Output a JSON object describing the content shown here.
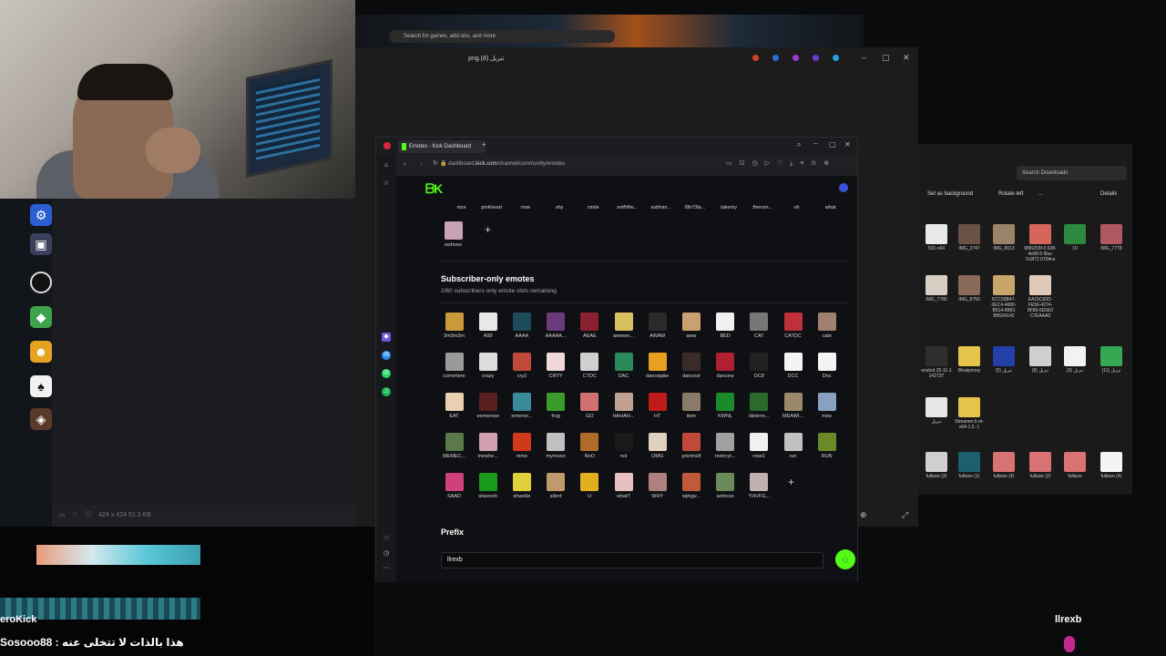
{
  "app": {
    "tab_title": "Emotes - Kick Dashboard",
    "url_prefix": "dashboard.",
    "url_domain": "kick.com",
    "url_path": "/channel/community/emotes",
    "logo_text": "ᗷK"
  },
  "background": {
    "game_search_placeholder": "Search for games, add-ons, and more",
    "viewer_title": "png.(8) تنزيل",
    "viewer_status": "424 x 424     51.3 KB",
    "explorer_search": "Search Downloads",
    "explorer_toolbar": [
      "Set as background",
      "Rotate left",
      "...",
      "Details"
    ]
  },
  "explorer_files": [
    {
      "label": "501-x64",
      "color": "#e8e8e8"
    },
    {
      "label": "IMG_2747",
      "color": "#6b5246"
    },
    {
      "label": "IMG_8013",
      "color": "#9a8366"
    },
    {
      "label": "6f0b203f-0 638-4e89-9 5ba-7e3f72 0704ce",
      "color": "#d6665a"
    },
    {
      "label": "10",
      "color": "#2b8a3e"
    },
    {
      "label": "IMG_7778",
      "color": "#b0585f"
    },
    {
      "label": "IMG_7780",
      "color": "#d9cfc4"
    },
    {
      "label": "IMG_8750",
      "color": "#8a6a58"
    },
    {
      "label": "6CC36B47- 0EC4-4680- B514-86B1 BB934142",
      "color": "#c8a56a"
    },
    {
      "label": "EA15C60D- FE56-4274- 8F80-5E5E0 C7EAAA0",
      "color": "#e0c9b6"
    },
    {
      "label": "enshot 25-11-1 142737",
      "color": "#2e2e2e"
    },
    {
      "label": "Bloatynosy",
      "color": "#e6c34a"
    },
    {
      "label": "تنزيل (5)",
      "color": "#2340a8"
    },
    {
      "label": "تنزيل (8)",
      "color": "#cfcfcf"
    },
    {
      "label": "تنزيل (3)",
      "color": "#f2f2f2"
    },
    {
      "label": "تنزيل (11)",
      "color": "#34a853"
    },
    {
      "label": "تنزيل",
      "color": "#e6e6e6"
    },
    {
      "label": "Streamer.b ot-x64-1.0. 1",
      "color": "#e6c34a"
    },
    {
      "label": "fullsize (3)",
      "color": "#cfcfcf"
    },
    {
      "label": "fullsize (1)",
      "color": "#1c6070"
    },
    {
      "label": "fullsize (4)",
      "color": "#d97272"
    },
    {
      "label": "fullsize (2)",
      "color": "#d97272"
    },
    {
      "label": "fullsize",
      "color": "#d97272"
    },
    {
      "label": "fullsize (4)",
      "color": "#f4f4f4"
    }
  ],
  "public_emotes_tail": [
    "nice",
    "pinkheart",
    "rose",
    "shy",
    "smile",
    "snifhflw...",
    "subhan...",
    "t9b73la...",
    "takemy",
    "therum...",
    "uh",
    "what"
  ],
  "public_last": {
    "label": "wshooo",
    "color": "#c7a2b3"
  },
  "subscriber": {
    "title": "Subscriber-only emotes",
    "desc": "2/60 subscribers only emote slots remaining",
    "emotes": [
      {
        "label": "3m3m3m",
        "color": "#c89a3a"
      },
      {
        "label": "A99",
        "color": "#e8e8e8"
      },
      {
        "label": "AAAA",
        "color": "#1d4b5c"
      },
      {
        "label": "AAAAA...",
        "color": "#6a3a7a"
      },
      {
        "label": "AEAE",
        "color": "#8a2030"
      },
      {
        "label": "aeeeee...",
        "color": "#d8c060"
      },
      {
        "label": "AWAW",
        "color": "#2a2a2a"
      },
      {
        "label": "aww",
        "color": "#c9a070"
      },
      {
        "label": "BED",
        "color": "#f0f0f0"
      },
      {
        "label": "CAT",
        "color": "#777777"
      },
      {
        "label": "CATDC",
        "color": "#c0303a"
      },
      {
        "label": "cate",
        "color": "#a08070"
      },
      {
        "label": "comehere",
        "color": "#9a9a9a"
      },
      {
        "label": "crazy",
        "color": "#dddddd"
      },
      {
        "label": "cry2",
        "color": "#c04a3a"
      },
      {
        "label": "CRYY",
        "color": "#f0d8d8"
      },
      {
        "label": "CTDC",
        "color": "#d0d0d0"
      },
      {
        "label": "DAC",
        "color": "#2a8a5a"
      },
      {
        "label": "dancejake",
        "color": "#e8a020"
      },
      {
        "label": "dancest",
        "color": "#3a2a2a"
      },
      {
        "label": "dancew",
        "color": "#b02030"
      },
      {
        "label": "DC8",
        "color": "#222222"
      },
      {
        "label": "DCC",
        "color": "#f4f4f4"
      },
      {
        "label": "Dnc",
        "color": "#f4f4f4"
      },
      {
        "label": "EAT",
        "color": "#e8d0b0"
      },
      {
        "label": "eememee",
        "color": "#5a2020"
      },
      {
        "label": "ememe...",
        "color": "#3a8a9a"
      },
      {
        "label": "frog",
        "color": "#3a9a2a"
      },
      {
        "label": "GO",
        "color": "#d07070"
      },
      {
        "label": "HAHAH...",
        "color": "#c0a090"
      },
      {
        "label": "HT",
        "color": "#c01a1a"
      },
      {
        "label": "item",
        "color": "#8a7a6a"
      },
      {
        "label": "KWNL",
        "color": "#1a8a2a"
      },
      {
        "label": "ldekmn...",
        "color": "#2a6a2a"
      },
      {
        "label": "MEAWI...",
        "color": "#9a8a6a"
      },
      {
        "label": "mee",
        "color": "#8aa0c0"
      },
      {
        "label": "MEMEC...",
        "color": "#5a7a4a"
      },
      {
        "label": "mewhe...",
        "color": "#d0a0b0"
      },
      {
        "label": "mmo",
        "color": "#d03a1a"
      },
      {
        "label": "mymooo",
        "color": "#c0c0c0"
      },
      {
        "label": "NoO",
        "color": "#b06a2a"
      },
      {
        "label": "not",
        "color": "#1a1a1a"
      },
      {
        "label": "OMG",
        "color": "#e0d0c0"
      },
      {
        "label": "prtctmslf",
        "color": "#c04a3a"
      },
      {
        "label": "rextrcyt...",
        "color": "#a0a0a0"
      },
      {
        "label": "rose1",
        "color": "#f0f0f0"
      },
      {
        "label": "run",
        "color": "#c0c0c0"
      },
      {
        "label": "RUN",
        "color": "#6a8a2a"
      },
      {
        "label": "SAAD",
        "color": "#d0407a"
      },
      {
        "label": "sheeesh",
        "color": "#1a9a1a"
      },
      {
        "label": "shwe6e",
        "color": "#e0d03a"
      },
      {
        "label": "silent",
        "color": "#c09a6a"
      },
      {
        "label": "U",
        "color": "#e0b020"
      },
      {
        "label": "whatT",
        "color": "#e8c0c0"
      },
      {
        "label": "WHY",
        "color": "#b08080"
      },
      {
        "label": "wjrkgv...",
        "color": "#c05a3a"
      },
      {
        "label": "wshooo",
        "color": "#6a8a5a"
      },
      {
        "label": "YHVFG...",
        "color": "#c0b0b0"
      }
    ]
  },
  "prefix": {
    "label": "Prefix",
    "value": "llrexb"
  },
  "chat": {
    "name": "eroKick",
    "message": "Sosooo88 : هذا بالذات لا تتخلى عنه",
    "right_name": "llrexb"
  },
  "colors": {
    "brand": "#53fc18"
  }
}
